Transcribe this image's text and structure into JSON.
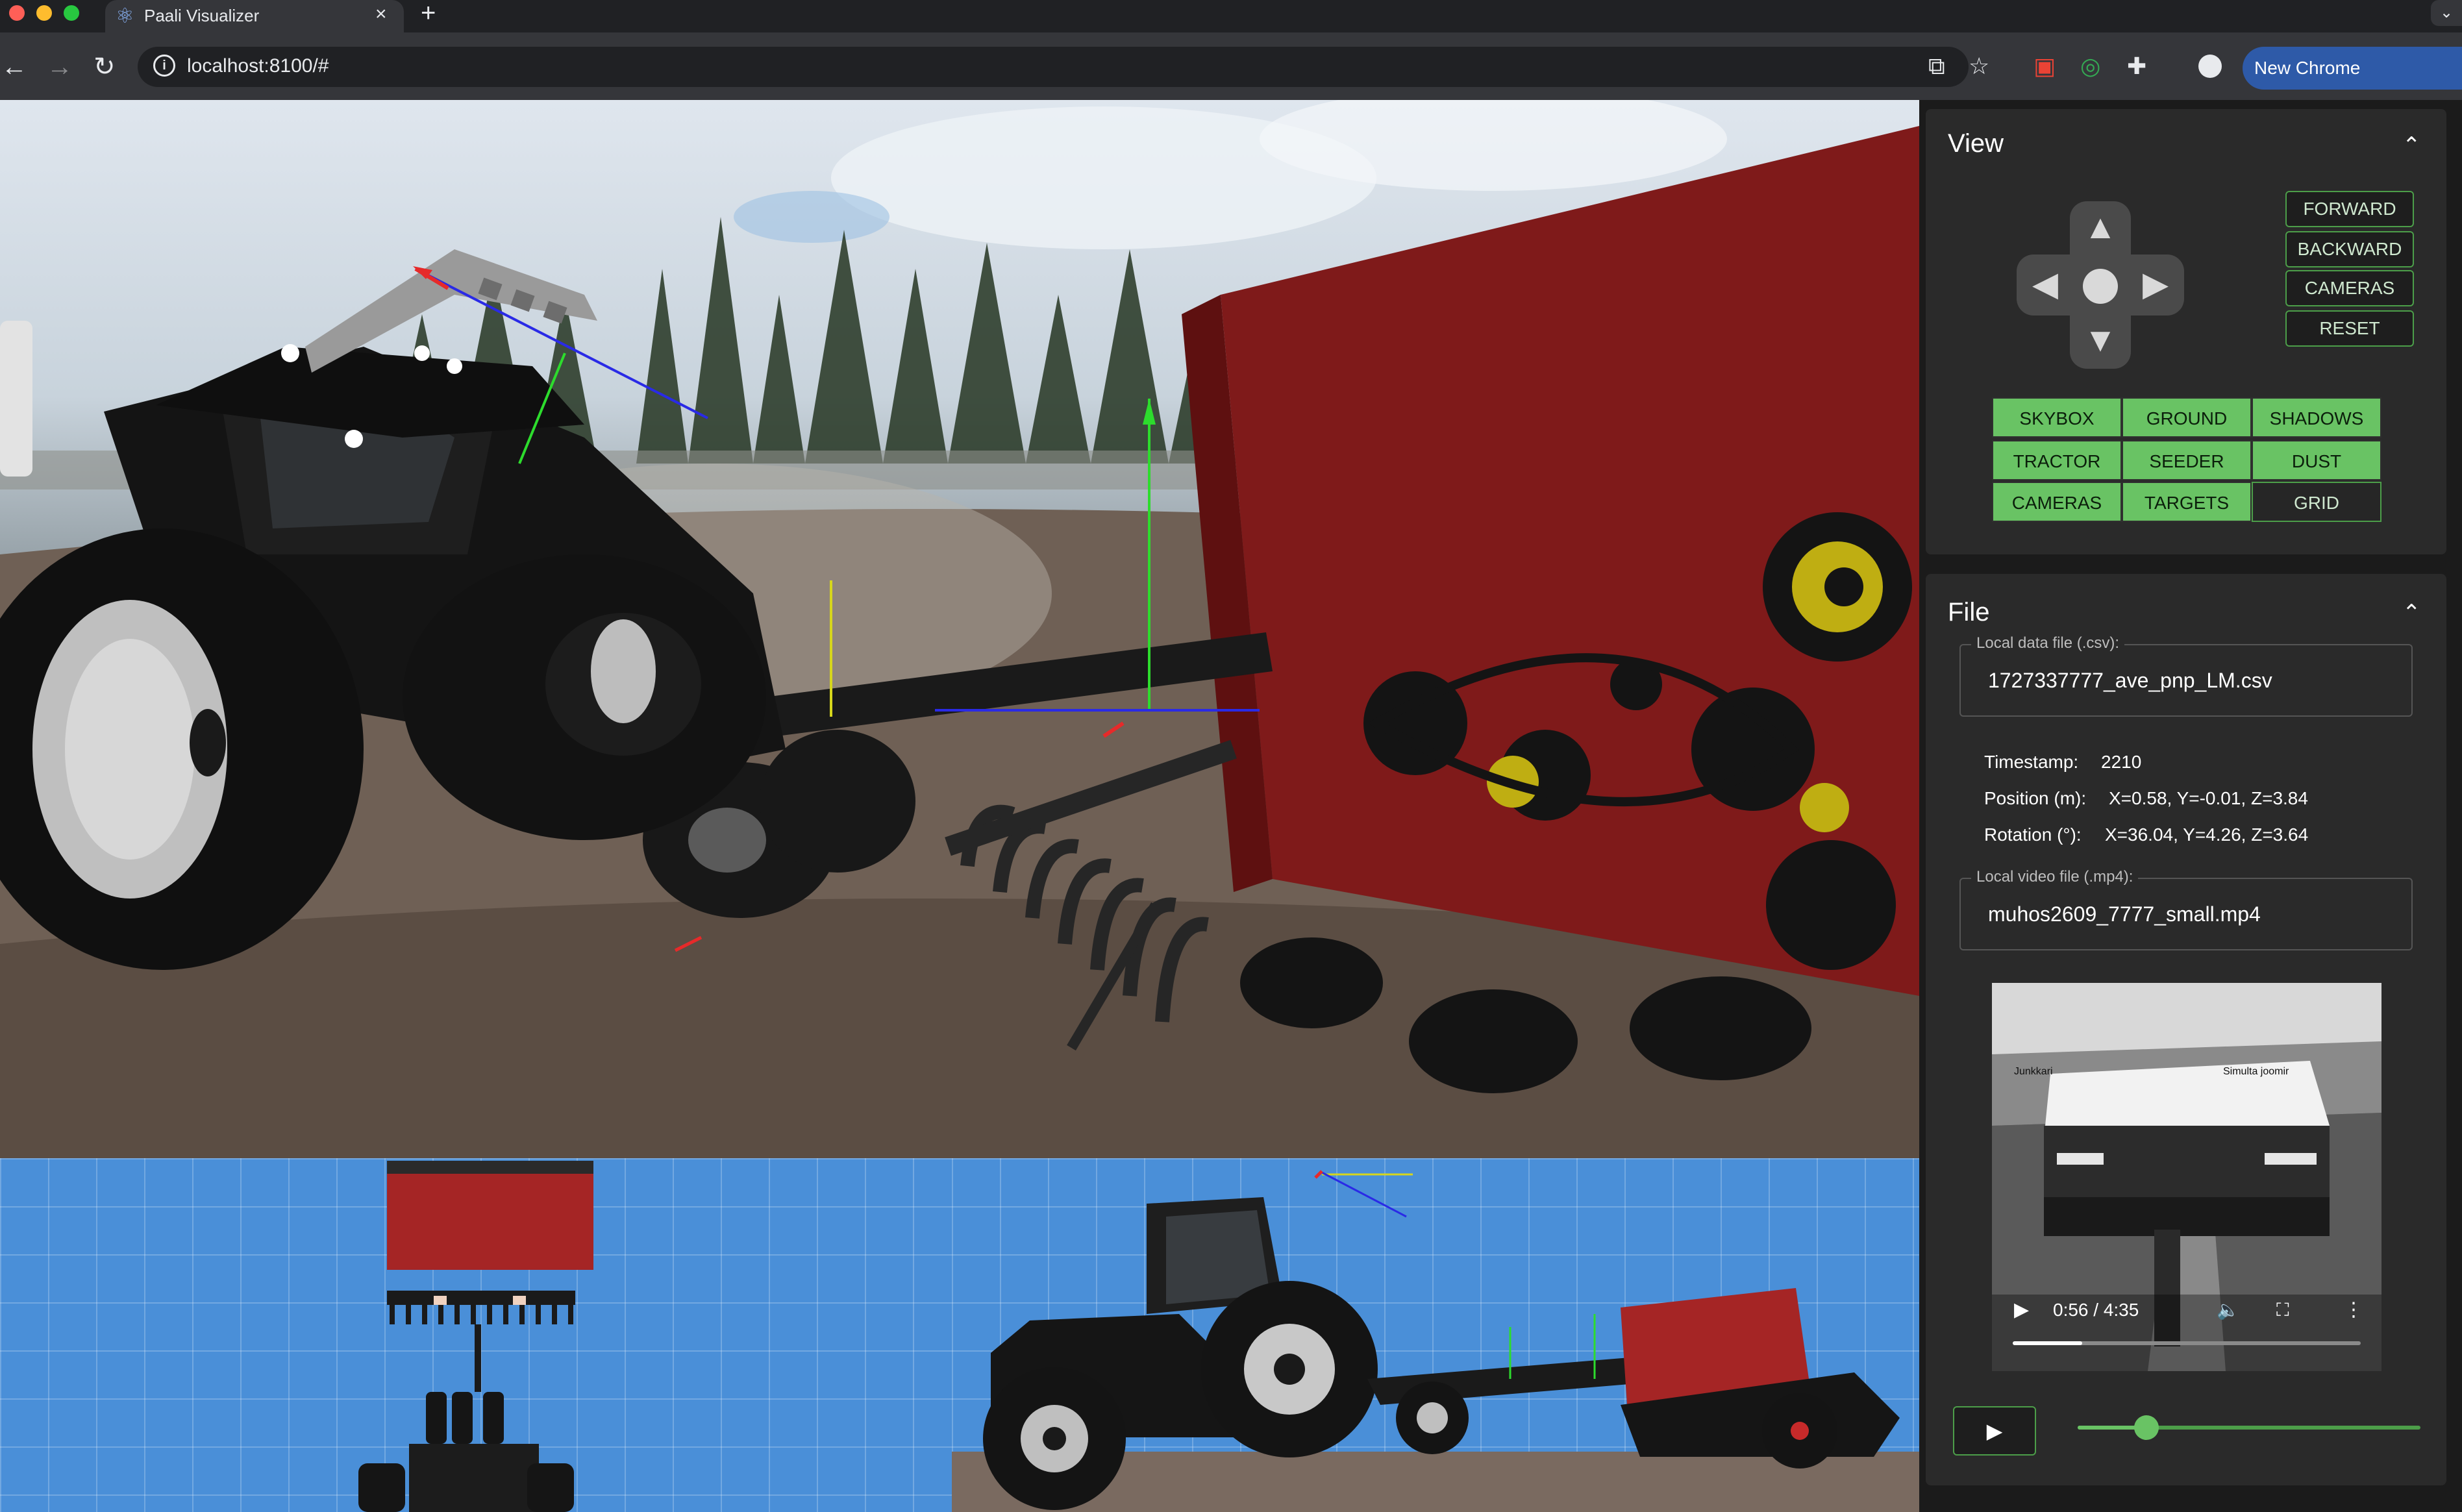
{
  "browser": {
    "tab_title": "Paali Visualizer",
    "url": "localhost:8100/#",
    "update_label": "New Chrome available"
  },
  "view_panel": {
    "title": "View",
    "camera_buttons": [
      "FORWARD",
      "BACKWARD",
      "CAMERAS",
      "RESET"
    ],
    "toggles": [
      {
        "label": "SKYBOX",
        "active": true
      },
      {
        "label": "GROUND",
        "active": true
      },
      {
        "label": "SHADOWS",
        "active": true
      },
      {
        "label": "TRACTOR",
        "active": true
      },
      {
        "label": "SEEDER",
        "active": true
      },
      {
        "label": "DUST",
        "active": true
      },
      {
        "label": "CAMERAS",
        "active": true
      },
      {
        "label": "TARGETS",
        "active": true
      },
      {
        "label": "GRID",
        "active": false
      }
    ]
  },
  "file_panel": {
    "title": "File",
    "data_file": {
      "label": "Local data file (.csv):",
      "value": "1727337777_ave_pnp_LM.csv"
    },
    "timestamp": {
      "key": "Timestamp:",
      "value": "2210"
    },
    "position": {
      "key": "Position (m):",
      "value": "X=0.58, Y=-0.01, Z=3.84"
    },
    "rotation": {
      "key": "Rotation (°):",
      "value": "X=36.04, Y=4.26, Z=3.64"
    },
    "video_file": {
      "label": "Local video file (.mp4):",
      "value": "muhos2609_7777_small.mp4"
    },
    "video_time": "0:56 / 4:35",
    "video_progress": 0.2,
    "video_overlay": {
      "left_sign": "Junkkari",
      "right_sign": "Simulta joomir"
    },
    "playback_progress": 0.2
  },
  "colors": {
    "accent_green": "#69c364",
    "viewport_blue": "#4a8fd8",
    "seeder_red": "#7f1a1a",
    "panel_bg": "#1b1b1b"
  }
}
